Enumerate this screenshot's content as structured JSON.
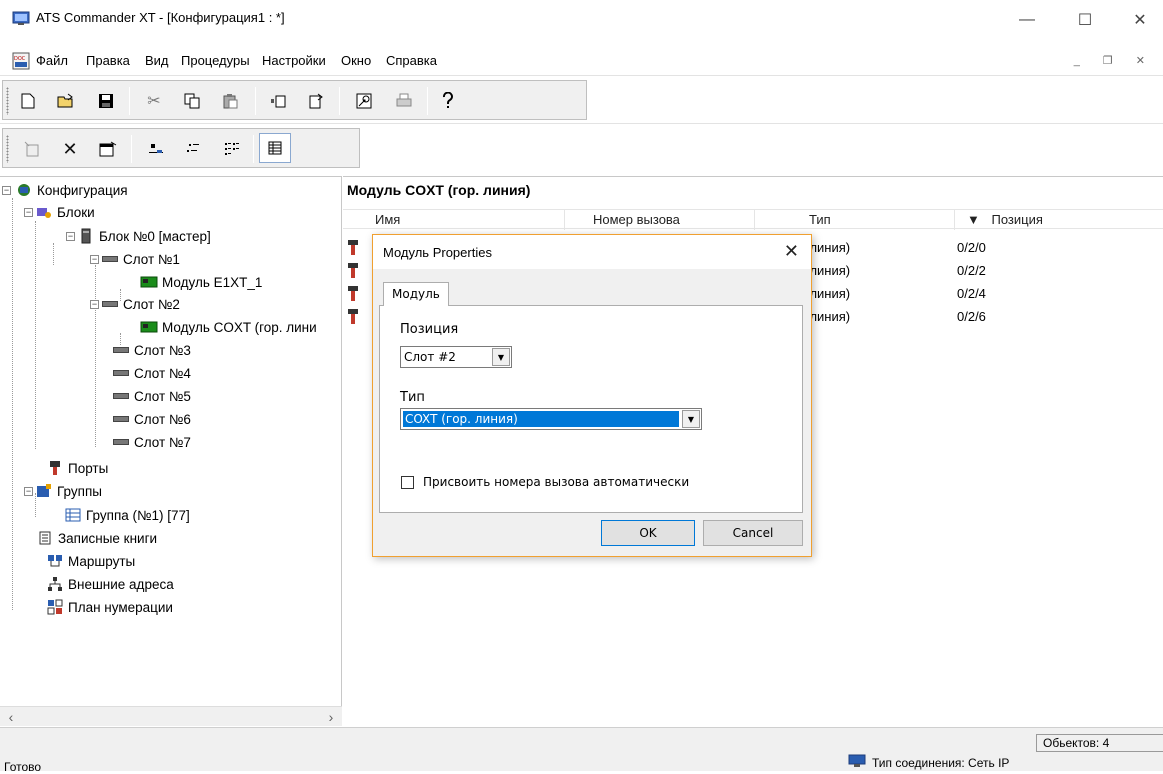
{
  "window": {
    "title": "ATS Commander XT - [Конфигурация1 : *]",
    "minimize": "—",
    "maximize": "☐",
    "close": "✕"
  },
  "menu": {
    "items": [
      "Файл",
      "Правка",
      "Вид",
      "Процедуры",
      "Настройки",
      "Окно",
      "Справка"
    ],
    "mdi_controls": "_ ❐ ✕"
  },
  "toolbar1": {
    "buttons": [
      {
        "name": "new-icon",
        "glyph": "🗋"
      },
      {
        "name": "open-icon",
        "glyph": "📂"
      },
      {
        "name": "save-icon",
        "glyph": "💾"
      },
      {
        "name": "cut-icon",
        "glyph": "✂"
      },
      {
        "name": "copy-icon",
        "glyph": "⎘"
      },
      {
        "name": "paste-icon",
        "glyph": "📋"
      },
      {
        "name": "new-item-icon",
        "glyph": "▫"
      },
      {
        "name": "open-item-icon",
        "glyph": "🗁"
      },
      {
        "name": "print-preview-icon",
        "glyph": "🖻"
      },
      {
        "name": "print-icon",
        "glyph": "🖨"
      },
      {
        "name": "help-icon",
        "glyph": "?"
      }
    ]
  },
  "toolbar2": {
    "buttons": [
      {
        "name": "properties-disabled-icon",
        "glyph": "⊞"
      },
      {
        "name": "delete-icon",
        "glyph": "✕"
      },
      {
        "name": "properties-icon",
        "glyph": "🗐"
      },
      {
        "name": "large-icons-icon",
        "glyph": "▭"
      },
      {
        "name": "small-icons-icon",
        "glyph": "⁘"
      },
      {
        "name": "list-view-icon",
        "glyph": "⋮⋮"
      },
      {
        "name": "details-view-icon",
        "glyph": "▦"
      }
    ]
  },
  "tree": {
    "nodes": [
      {
        "label": "Конфигурация",
        "icon": "config-icon"
      },
      {
        "label": "Блоки",
        "icon": "blocks-icon"
      },
      {
        "label": "Блок №0 [мастер]",
        "icon": "block-icon"
      },
      {
        "label": "Слот №1",
        "icon": "slot-icon"
      },
      {
        "label": "Модуль E1XT_1",
        "icon": "module-icon"
      },
      {
        "label": "Слот №2",
        "icon": "slot-icon"
      },
      {
        "label": "Модуль COXT (гор. лини",
        "icon": "module-icon"
      },
      {
        "label": "Слот №3",
        "icon": "slot-icon"
      },
      {
        "label": "Слот №4",
        "icon": "slot-icon"
      },
      {
        "label": "Слот №5",
        "icon": "slot-icon"
      },
      {
        "label": "Слот №6",
        "icon": "slot-icon"
      },
      {
        "label": "Слот №7",
        "icon": "slot-icon"
      },
      {
        "label": "Порты",
        "icon": "ports-icon"
      },
      {
        "label": "Группы",
        "icon": "groups-icon"
      },
      {
        "label": "Группа (№1) [77]",
        "icon": "group-icon"
      },
      {
        "label": "Записные книги",
        "icon": "notebook-icon"
      },
      {
        "label": "Маршруты",
        "icon": "routes-icon"
      },
      {
        "label": "Внешние адреса",
        "icon": "external-addresses-icon"
      },
      {
        "label": "План нумерации",
        "icon": "numbering-plan-icon"
      }
    ],
    "scroll_left": "‹",
    "scroll_right": "›"
  },
  "list": {
    "title": "Модуль COXT (гор. линия)",
    "columns": [
      "Имя",
      "Номер вызова",
      "Тип",
      "Позиция"
    ],
    "sort_indicator": "▼",
    "rows": [
      {
        "type": "р. линия)",
        "position": "0/2/0"
      },
      {
        "type": "р. линия)",
        "position": "0/2/2"
      },
      {
        "type": "р. линия)",
        "position": "0/2/4"
      },
      {
        "type": "р. линия)",
        "position": "0/2/6"
      }
    ]
  },
  "dialog": {
    "title": "Модуль Properties",
    "close": "✕",
    "tab": "Модуль",
    "position_label": "Позиция",
    "position_value": "Слот #2",
    "type_label": "Тип",
    "type_value": "COXT (гор. линия)",
    "auto_assign_label": "Присвоить номера вызова автоматически",
    "ok": "OK",
    "cancel": "Cancel"
  },
  "status": {
    "ready": "Готово",
    "objects": "Обьектов: 4",
    "connection": "Тип соединения: Сеть IP"
  }
}
